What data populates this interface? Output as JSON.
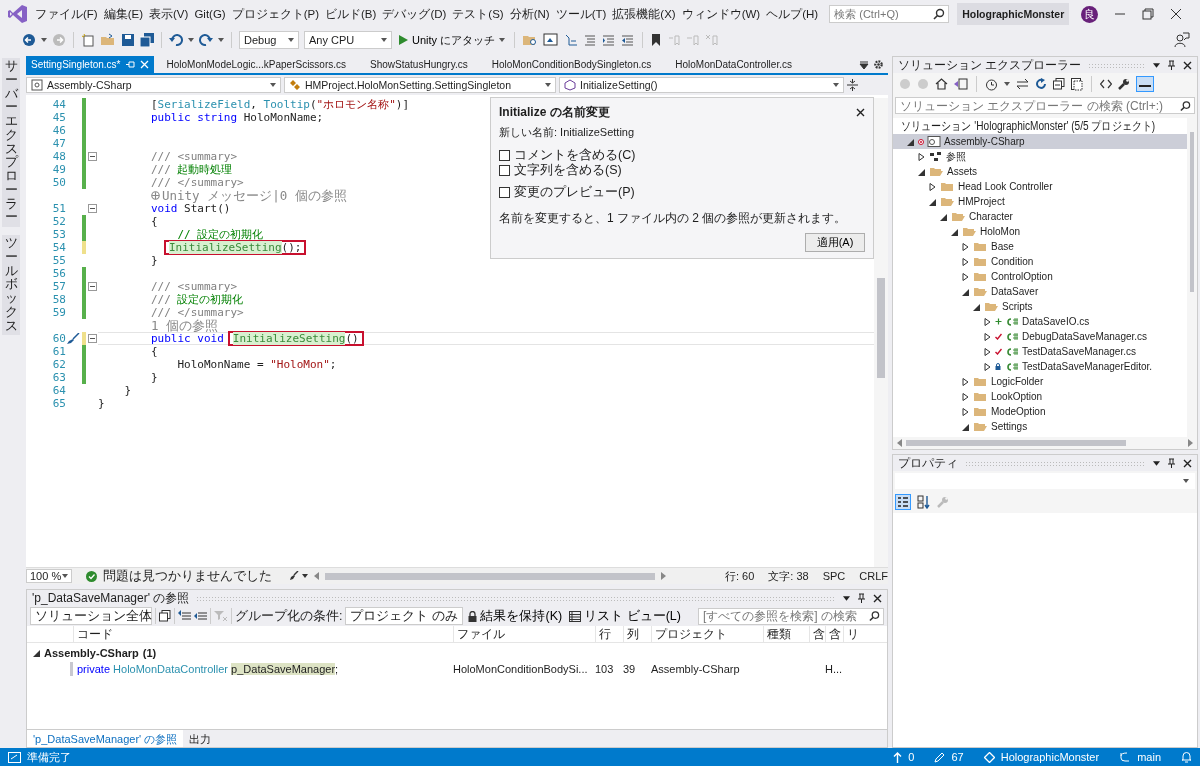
{
  "menu": [
    "ファイル(F)",
    "編集(E)",
    "表示(V)",
    "Git(G)",
    "プロジェクト(P)",
    "ビルド(B)",
    "デバッグ(D)",
    "テスト(S)",
    "分析(N)",
    "ツール(T)",
    "拡張機能(X)",
    "ウィンドウ(W)",
    "ヘルプ(H)"
  ],
  "search": {
    "placeholder": "検索 (Ctrl+Q)"
  },
  "solution_name": "HolographicMonster",
  "account": {
    "initial": "良"
  },
  "toolbar": {
    "configuration": "Debug",
    "platform": "Any CPU",
    "run_button": "Unity にアタッチ"
  },
  "side_tabs": [
    "サーバーエクスプローラー",
    "ツールボックス"
  ],
  "tabs": [
    {
      "label": "SettingSingleton.cs*",
      "selected": true
    },
    {
      "label": "HoloMonModeLogic...kPaperScissors.cs",
      "selected": false
    },
    {
      "label": "ShowStatusHungry.cs",
      "selected": false
    },
    {
      "label": "HoloMonConditionBodySingleton.cs",
      "selected": false
    },
    {
      "label": "HoloMonDataController.cs",
      "selected": false
    }
  ],
  "nav_bar": [
    "Assembly-CSharp",
    "HMProject.HoloMonSetting.SettingSingleton",
    "InitializeSetting()"
  ],
  "code_lines": [
    {
      "kind": "code",
      "num": "44",
      "changed": true,
      "saved": true,
      "fold": false,
      "current": false,
      "quick_action": false,
      "tokens": [
        {
          "t": "        [",
          "kind": "plain"
        },
        {
          "t": "SerializeField",
          "kind": "type"
        },
        {
          "t": ", ",
          "kind": "plain"
        },
        {
          "t": "Tooltip",
          "kind": "type"
        },
        {
          "t": "(",
          "kind": "plain"
        },
        {
          "t": "\"ホロモン名称\"",
          "kind": "str"
        },
        {
          "t": ")]",
          "kind": "plain"
        }
      ]
    },
    {
      "kind": "code",
      "num": "45",
      "changed": true,
      "saved": true,
      "fold": false,
      "current": false,
      "quick_action": false,
      "tokens": [
        {
          "t": "        public string",
          "kind": "kw"
        },
        {
          "t": " HoloMonName;",
          "kind": "plain"
        }
      ]
    },
    {
      "kind": "code",
      "num": "46",
      "changed": true,
      "saved": true,
      "fold": false,
      "current": false,
      "quick_action": false
    },
    {
      "kind": "code",
      "num": "47",
      "changed": true,
      "saved": true,
      "fold": false,
      "current": false,
      "quick_action": false
    },
    {
      "kind": "code",
      "num": "48",
      "changed": true,
      "saved": true,
      "fold": true,
      "current": false,
      "quick_action": false,
      "tokens": [
        {
          "t": "        /// <summary>",
          "kind": "doc"
        }
      ]
    },
    {
      "kind": "code",
      "num": "49",
      "changed": true,
      "saved": true,
      "fold": false,
      "current": false,
      "quick_action": false,
      "tokens": [
        {
          "t": "        ///",
          "kind": "doc"
        },
        {
          "t": " 起動時処理",
          "kind": "com"
        }
      ]
    },
    {
      "kind": "code",
      "num": "50",
      "changed": true,
      "saved": true,
      "fold": false,
      "current": false,
      "quick_action": false,
      "tokens": [
        {
          "t": "        /// </summary>",
          "kind": "doc"
        }
      ]
    },
    {
      "kind": "lens",
      "unity": true,
      "text": "Unity メッセージ|0 個の参照"
    },
    {
      "kind": "code",
      "num": "51",
      "changed": false,
      "fold": true,
      "current": false,
      "quick_action": false,
      "tokens": [
        {
          "t": "        void",
          "kind": "kw"
        },
        {
          "t": " Start()",
          "kind": "plain"
        }
      ]
    },
    {
      "kind": "code",
      "num": "52",
      "changed": true,
      "saved": true,
      "fold": false,
      "current": false,
      "quick_action": false,
      "tokens": [
        {
          "t": "        {",
          "kind": "plain"
        }
      ]
    },
    {
      "kind": "code",
      "num": "53",
      "changed": true,
      "saved": true,
      "fold": false,
      "current": false,
      "quick_action": false,
      "tokens": [
        {
          "t": "            // 設定の初期化",
          "kind": "com"
        }
      ]
    },
    {
      "kind": "code",
      "num": "54",
      "changed": true,
      "saved": false,
      "fold": false,
      "current": false,
      "quick_action": false,
      "boxed": [
        {
          "t": "InitializeSetting",
          "kind": "hl"
        },
        {
          "t": "();",
          "kind": "plain"
        }
      ]
    },
    {
      "kind": "code",
      "num": "55",
      "changed": false,
      "fold": false,
      "current": false,
      "quick_action": false,
      "tokens": [
        {
          "t": "        }",
          "kind": "plain"
        }
      ]
    },
    {
      "kind": "code",
      "num": "56",
      "changed": true,
      "saved": true,
      "fold": false,
      "current": false,
      "quick_action": false
    },
    {
      "kind": "code",
      "num": "57",
      "changed": true,
      "saved": true,
      "fold": true,
      "current": false,
      "quick_action": false,
      "tokens": [
        {
          "t": "        /// <summary>",
          "kind": "doc"
        }
      ]
    },
    {
      "kind": "code",
      "num": "58",
      "changed": true,
      "saved": true,
      "fold": false,
      "current": false,
      "quick_action": false,
      "tokens": [
        {
          "t": "        ///",
          "kind": "doc"
        },
        {
          "t": " 設定の初期化",
          "kind": "com"
        }
      ]
    },
    {
      "kind": "code",
      "num": "59",
      "changed": true,
      "saved": true,
      "fold": false,
      "current": false,
      "quick_action": false,
      "tokens": [
        {
          "t": "        /// </summary>",
          "kind": "doc"
        }
      ]
    },
    {
      "kind": "lens",
      "unity": false,
      "text": "1 個の参照"
    },
    {
      "kind": "code",
      "num": "60",
      "changed": true,
      "saved": false,
      "fold": true,
      "current": true,
      "quick_action": true,
      "tokens": [
        {
          "t": "        public void",
          "kind": "kw"
        }
      ],
      "boxed": [
        {
          "t": "InitializeSetting",
          "kind": "hl"
        },
        {
          "t": "()",
          "kind": "plain"
        }
      ]
    },
    {
      "kind": "code",
      "num": "61",
      "changed": true,
      "saved": true,
      "fold": false,
      "current": false,
      "quick_action": false,
      "tokens": [
        {
          "t": "        {",
          "kind": "plain"
        }
      ]
    },
    {
      "kind": "code",
      "num": "62",
      "changed": true,
      "saved": true,
      "fold": false,
      "current": false,
      "quick_action": false,
      "tokens": [
        {
          "t": "            HoloMonName = ",
          "kind": "plain"
        },
        {
          "t": "\"HoloMon\"",
          "kind": "str"
        },
        {
          "t": ";",
          "kind": "plain"
        }
      ]
    },
    {
      "kind": "code",
      "num": "63",
      "changed": true,
      "saved": true,
      "fold": false,
      "current": false,
      "quick_action": false,
      "tokens": [
        {
          "t": "        }",
          "kind": "plain"
        }
      ]
    },
    {
      "kind": "code",
      "num": "64",
      "changed": false,
      "fold": false,
      "current": false,
      "quick_action": false,
      "tokens": [
        {
          "t": "    }",
          "kind": "plain"
        }
      ]
    },
    {
      "kind": "code",
      "num": "65",
      "changed": false,
      "fold": false,
      "current": false,
      "quick_action": false,
      "tokens": [
        {
          "t": "}",
          "kind": "plain"
        }
      ]
    }
  ],
  "rename_dialog": {
    "title": "Initialize の名前変更",
    "new_name": "新しい名前: InitializeSetting",
    "options": [
      {
        "label": "コメントを含める(C)",
        "checked": false
      },
      {
        "label": "文字列を含める(S)",
        "checked": false
      },
      {
        "label": "変更のプレビュー(P)",
        "checked": false
      }
    ],
    "message": "名前を変更すると、1 ファイル内の 2 個の参照が更新されます。",
    "apply_button": "適用(A)"
  },
  "editor_status": {
    "zoom": "100 %",
    "issues": "問題は見つかりませんでした",
    "line": "行: 60",
    "char": "文字: 38",
    "whitespace": "SPC",
    "line_ending": "CRLF"
  },
  "references": {
    "title": "'p_DataSaveManager' の参照",
    "scope": "ソリューション全体",
    "group_by_label": "グループ化の条件:",
    "group_by": "プロジェクト のみ",
    "keep_results": "結果を保持(K)",
    "list_view": "リスト ビュー(L)",
    "search_placeholder": "[すべての参照を検索] の検索",
    "columns": [
      "コード",
      "ファイル",
      "行",
      "列",
      "プロジェクト",
      "種類",
      "含",
      "含",
      "リ"
    ],
    "groups": [
      {
        "label": "Assembly-CSharp",
        "count": "(1)",
        "expanded": true,
        "rows": [
          {
            "code": [
              {
                "t": "private",
                "kind": "kw"
              },
              {
                "t": " HoloMonDataController ",
                "kind": "type"
              },
              {
                "t": "p_DataSaveManager",
                "kind": "ref"
              },
              {
                "t": ";",
                "kind": "plain"
              }
            ],
            "file": "HoloMonConditionBodySi...",
            "line": "103",
            "column": "39",
            "project": "Assembly-CSharp",
            "column_8": "H..."
          }
        ]
      }
    ]
  },
  "bottom_tabs": [
    {
      "label": "'p_DataSaveManager' の参照",
      "selected": true
    },
    {
      "label": "出力",
      "selected": false
    }
  ],
  "solution_explorer": {
    "title": "ソリューション エクスプローラー",
    "search_placeholder": "ソリューション エクスプローラー の検索 (Ctrl+:)",
    "tree": [
      {
        "label": "ソリューション 'HolographicMonster' (5/5 プロジェクト)",
        "kind": "solution",
        "selected": false,
        "expanded": true,
        "children": [
          {
            "label": "Assembly-CSharp",
            "kind": "project",
            "selected": true,
            "expanded": true,
            "children": [
              {
                "label": "参照",
                "kind": "references",
                "selected": false,
                "expanded": false
              },
              {
                "label": "Assets",
                "kind": "folder",
                "selected": false,
                "expanded": true,
                "children": [
                  {
                    "label": "Head Look Controller",
                    "kind": "folder",
                    "selected": false,
                    "expanded": false
                  },
                  {
                    "label": "HMProject",
                    "kind": "folder",
                    "selected": false,
                    "expanded": true,
                    "children": [
                      {
                        "label": "Character",
                        "kind": "folder",
                        "selected": false,
                        "expanded": true,
                        "children": [
                          {
                            "label": "HoloMon",
                            "kind": "folder",
                            "selected": false,
                            "expanded": true,
                            "children": [
                              {
                                "label": "Base",
                                "kind": "folder",
                                "selected": false,
                                "expanded": false
                              },
                              {
                                "label": "Condition",
                                "kind": "folder",
                                "selected": false,
                                "expanded": false
                              },
                              {
                                "label": "ControlOption",
                                "kind": "folder",
                                "selected": false,
                                "expanded": false
                              },
                              {
                                "label": "DataSaver",
                                "kind": "folder",
                                "selected": false,
                                "expanded": true,
                                "children": [
                                  {
                                    "label": "Scripts",
                                    "kind": "folder",
                                    "selected": false,
                                    "expanded": true,
                                    "children": [
                                      {
                                        "label": "DataSaveIO.cs",
                                        "kind": "file",
                                        "added": true,
                                        "modified": false,
                                        "locked": false,
                                        "selected": false,
                                        "expanded": false
                                      },
                                      {
                                        "label": "DebugDataSaveManager.cs",
                                        "kind": "file",
                                        "added": false,
                                        "modified": true,
                                        "locked": false,
                                        "selected": false,
                                        "expanded": false
                                      },
                                      {
                                        "label": "TestDataSaveManager.cs",
                                        "kind": "file",
                                        "added": false,
                                        "modified": true,
                                        "locked": false,
                                        "selected": false,
                                        "expanded": false
                                      },
                                      {
                                        "label": "TestDataSaveManagerEditor.",
                                        "kind": "file",
                                        "added": false,
                                        "modified": false,
                                        "locked": true,
                                        "selected": false,
                                        "expanded": false
                                      }
                                    ]
                                  }
                                ]
                              },
                              {
                                "label": "LogicFolder",
                                "kind": "folder",
                                "selected": false,
                                "expanded": false
                              },
                              {
                                "label": "LookOption",
                                "kind": "folder",
                                "selected": false,
                                "expanded": false
                              },
                              {
                                "label": "ModeOption",
                                "kind": "folder",
                                "selected": false,
                                "expanded": false
                              },
                              {
                                "label": "Settings",
                                "kind": "folder",
                                "selected": false,
                                "expanded": true
                              }
                            ]
                          }
                        ]
                      }
                    ]
                  }
                ]
              }
            ]
          }
        ]
      }
    ]
  },
  "properties": {
    "title": "プロパティ"
  },
  "status_bar": {
    "message": "準備完了",
    "pushes": "0",
    "changes": "67",
    "repository": "HolographicMonster",
    "branch": "main"
  }
}
